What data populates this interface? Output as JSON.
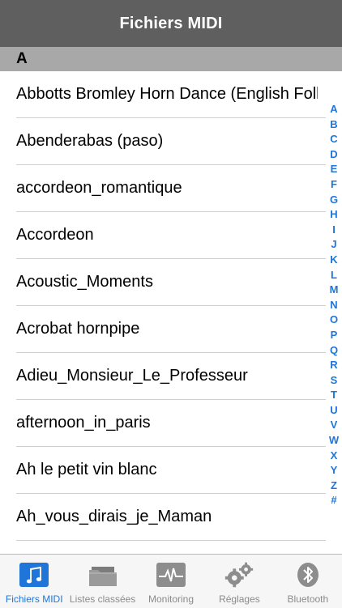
{
  "navbar": {
    "title": "Fichiers MIDI"
  },
  "section": {
    "letter": "A"
  },
  "files": [
    "Abbotts Bromley Horn Dance (English Folk)",
    "Abenderabas (paso)",
    "accordeon_romantique",
    "Accordeon",
    "Acoustic_Moments",
    "Acrobat hornpipe",
    "Adieu_Monsieur_Le_Professeur",
    "afternoon_in_paris",
    "Ah le petit vin blanc",
    "Ah_vous_dirais_je_Maman"
  ],
  "index": [
    "A",
    "B",
    "C",
    "D",
    "E",
    "F",
    "G",
    "H",
    "I",
    "J",
    "K",
    "L",
    "M",
    "N",
    "O",
    "P",
    "Q",
    "R",
    "S",
    "T",
    "U",
    "V",
    "W",
    "X",
    "Y",
    "Z",
    "#"
  ],
  "tabs": [
    {
      "label": "Fichiers MIDI",
      "icon": "music-note-icon",
      "active": true
    },
    {
      "label": "Listes classées",
      "icon": "folder-icon",
      "active": false
    },
    {
      "label": "Monitoring",
      "icon": "waveform-icon",
      "active": false
    },
    {
      "label": "Réglages",
      "icon": "gears-icon",
      "active": false
    },
    {
      "label": "Bluetooth",
      "icon": "bluetooth-icon",
      "active": false
    }
  ],
  "colors": {
    "accent": "#1f76d8",
    "navbar": "#5f5f5f",
    "section": "#a8a8a8",
    "tab_inactive": "#8a8a8a"
  }
}
